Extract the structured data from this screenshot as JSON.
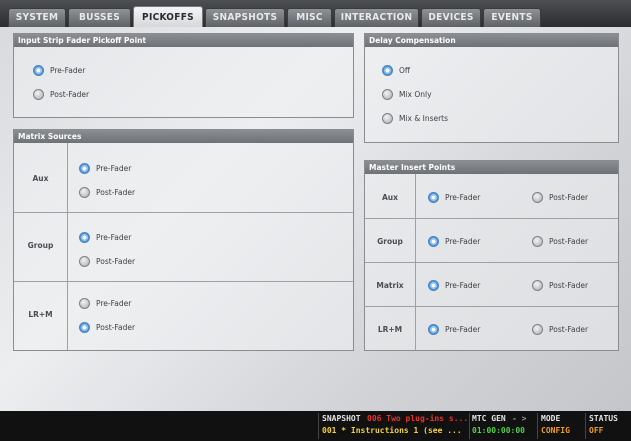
{
  "tabs": [
    "SYSTEM",
    "BUSSES",
    "PICKOFFS",
    "SNAPSHOTS",
    "MISC",
    "INTERACTION",
    "DEVICES",
    "EVENTS"
  ],
  "active_tab": "PICKOFFS",
  "input_strip": {
    "title": "Input Strip Fader Pickoff Point",
    "options": [
      "Pre-Fader",
      "Post-Fader"
    ],
    "selected": "Pre-Fader"
  },
  "delay_comp": {
    "title": "Delay Compensation",
    "options": [
      "Off",
      "Mix Only",
      "Mix & Inserts"
    ],
    "selected": "Off"
  },
  "matrix_sources": {
    "title": "Matrix Sources",
    "rows": [
      {
        "label": "Aux",
        "options": [
          "Pre-Fader",
          "Post-Fader"
        ],
        "selected": "Pre-Fader"
      },
      {
        "label": "Group",
        "options": [
          "Pre-Fader",
          "Post-Fader"
        ],
        "selected": "Pre-Fader"
      },
      {
        "label": "LR+M",
        "options": [
          "Pre-Fader",
          "Post-Fader"
        ],
        "selected": "Post-Fader"
      }
    ]
  },
  "master_insert": {
    "title": "Master Insert Points",
    "rows": [
      {
        "label": "Aux",
        "options": [
          "Pre-Fader",
          "Post-Fader"
        ],
        "selected": "Pre-Fader"
      },
      {
        "label": "Group",
        "options": [
          "Pre-Fader",
          "Post-Fader"
        ],
        "selected": "Pre-Fader"
      },
      {
        "label": "Matrix",
        "options": [
          "Pre-Fader",
          "Post-Fader"
        ],
        "selected": "Pre-Fader"
      },
      {
        "label": "LR+M",
        "options": [
          "Pre-Fader",
          "Post-Fader"
        ],
        "selected": "Pre-Fader"
      }
    ]
  },
  "status_bar": {
    "snapshot_label": "SNAPSHOT",
    "snapshot_current": "006 Two plug-ins s...",
    "snapshot_next": "001 * Instructions 1 (see ...",
    "mtc_label": "MTC GEN",
    "mtc_arrow": "- >",
    "mtc_value": "01:00:00:00",
    "mode_label": "MODE",
    "mode_value": "CONFIG",
    "status_label": "STATUS",
    "status_value": "OFF"
  }
}
